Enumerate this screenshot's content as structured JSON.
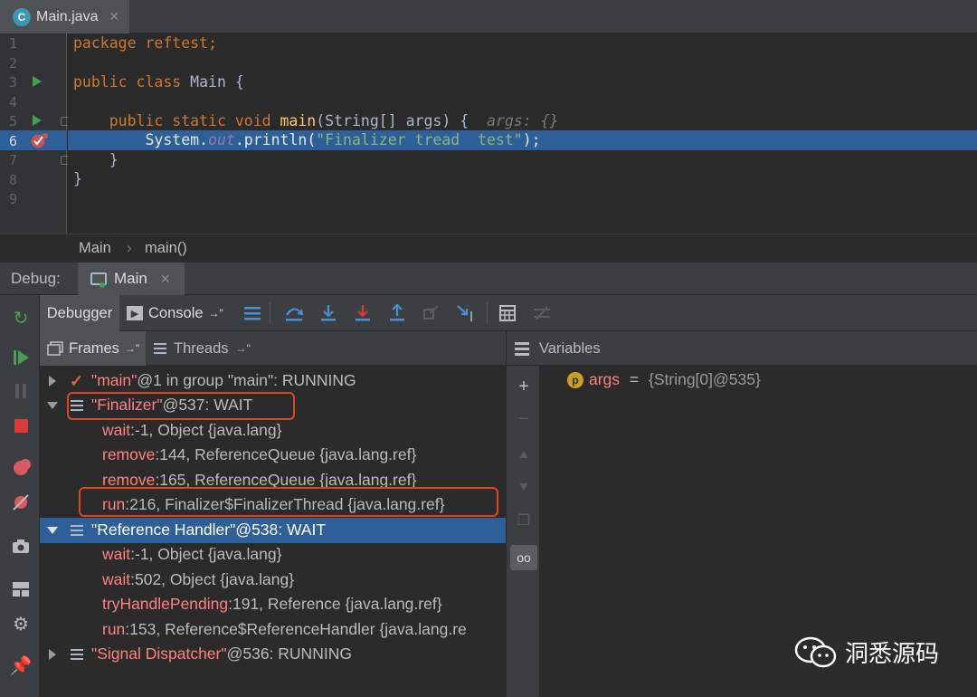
{
  "editor_tab": {
    "file_name": "Main.java",
    "icon_letter": "C"
  },
  "editor": {
    "line_numbers": [
      "1",
      "2",
      "3",
      "4",
      "5",
      "6",
      "7",
      "8",
      "9"
    ],
    "line1": {
      "kw": "package",
      "rest": " reftest;"
    },
    "line3": {
      "kw": "public class",
      "name": " Main {"
    },
    "line5": {
      "indent": "    ",
      "kw": "public static void",
      "fn": "main",
      "params": "(String[] args) {",
      "hint": "  args: {}"
    },
    "line6": {
      "indent": "        ",
      "recv": "System.",
      "field": "out",
      "call": ".println(",
      "str": "\"Finalizer tread  test\"",
      "end": ");"
    },
    "line7": "    }",
    "line8": "}"
  },
  "breadcrumbs": {
    "class_name": "Main",
    "separator": "›",
    "method": "main()"
  },
  "debug": {
    "label": "Debug:",
    "session_name": "Main",
    "tabs": {
      "debugger": "Debugger",
      "console": "Console",
      "console_suffix": "→\""
    },
    "frames_tab": "Frames",
    "frames_suffix": "→\"",
    "threads_tab": "Threads",
    "threads_suffix": "→\"",
    "variables_tab": "Variables"
  },
  "threads": [
    {
      "quoted": "\"main\"",
      "rest": "@1 in group \"main\": RUNNING"
    },
    {
      "quoted": "\"Finalizer\"",
      "rest": "@537: WAIT"
    },
    {
      "quoted": "\"Reference Handler\"",
      "rest": "@538: WAIT"
    },
    {
      "quoted": "\"Signal Dispatcher\"",
      "rest": "@536: RUNNING"
    }
  ],
  "finalizer_frames": [
    {
      "method": "wait",
      "rest": ":-1, Object {java.lang}"
    },
    {
      "method": "remove",
      "rest": ":144, ReferenceQueue {java.lang.ref}"
    },
    {
      "method": "remove",
      "rest": ":165, ReferenceQueue {java.lang.ref}"
    },
    {
      "method": "run",
      "rest": ":216, Finalizer$FinalizerThread {java.lang.ref}"
    }
  ],
  "refhandler_frames": [
    {
      "method": "wait",
      "rest": ":-1, Object {java.lang}"
    },
    {
      "method": "wait",
      "rest": ":502, Object {java.lang}"
    },
    {
      "method": "tryHandlePending",
      "rest": ":191, Reference {java.lang.ref}"
    },
    {
      "method": "run",
      "rest": ":153, Reference$ReferenceHandler {java.lang.re"
    }
  ],
  "variables": [
    {
      "badge": "p",
      "name": "args",
      "eq": " = ",
      "value": "{String[0]@535}"
    }
  ],
  "watermark": "洞悉源码",
  "colors": {
    "selection": "#2d6099",
    "keyword": "#cc7832",
    "method": "#ffc66d",
    "string": "#6a8759",
    "annotation_box": "#e0461e",
    "frame_method": "#ff8080"
  }
}
